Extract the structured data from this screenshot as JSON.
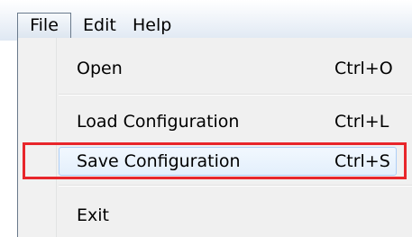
{
  "menubar": {
    "items": [
      {
        "label": "File"
      },
      {
        "label": "Edit"
      },
      {
        "label": "Help"
      }
    ]
  },
  "file_menu": {
    "items": [
      {
        "label": "Open",
        "shortcut": "Ctrl+O"
      },
      {
        "label": "Load Configuration",
        "shortcut": "Ctrl+L"
      },
      {
        "label": "Save Configuration",
        "shortcut": "Ctrl+S",
        "state": "hovered"
      },
      {
        "label": "Exit",
        "shortcut": ""
      }
    ]
  },
  "annotation": {
    "highlight_color": "#e8262b",
    "highlighted_item": "Save Configuration"
  }
}
